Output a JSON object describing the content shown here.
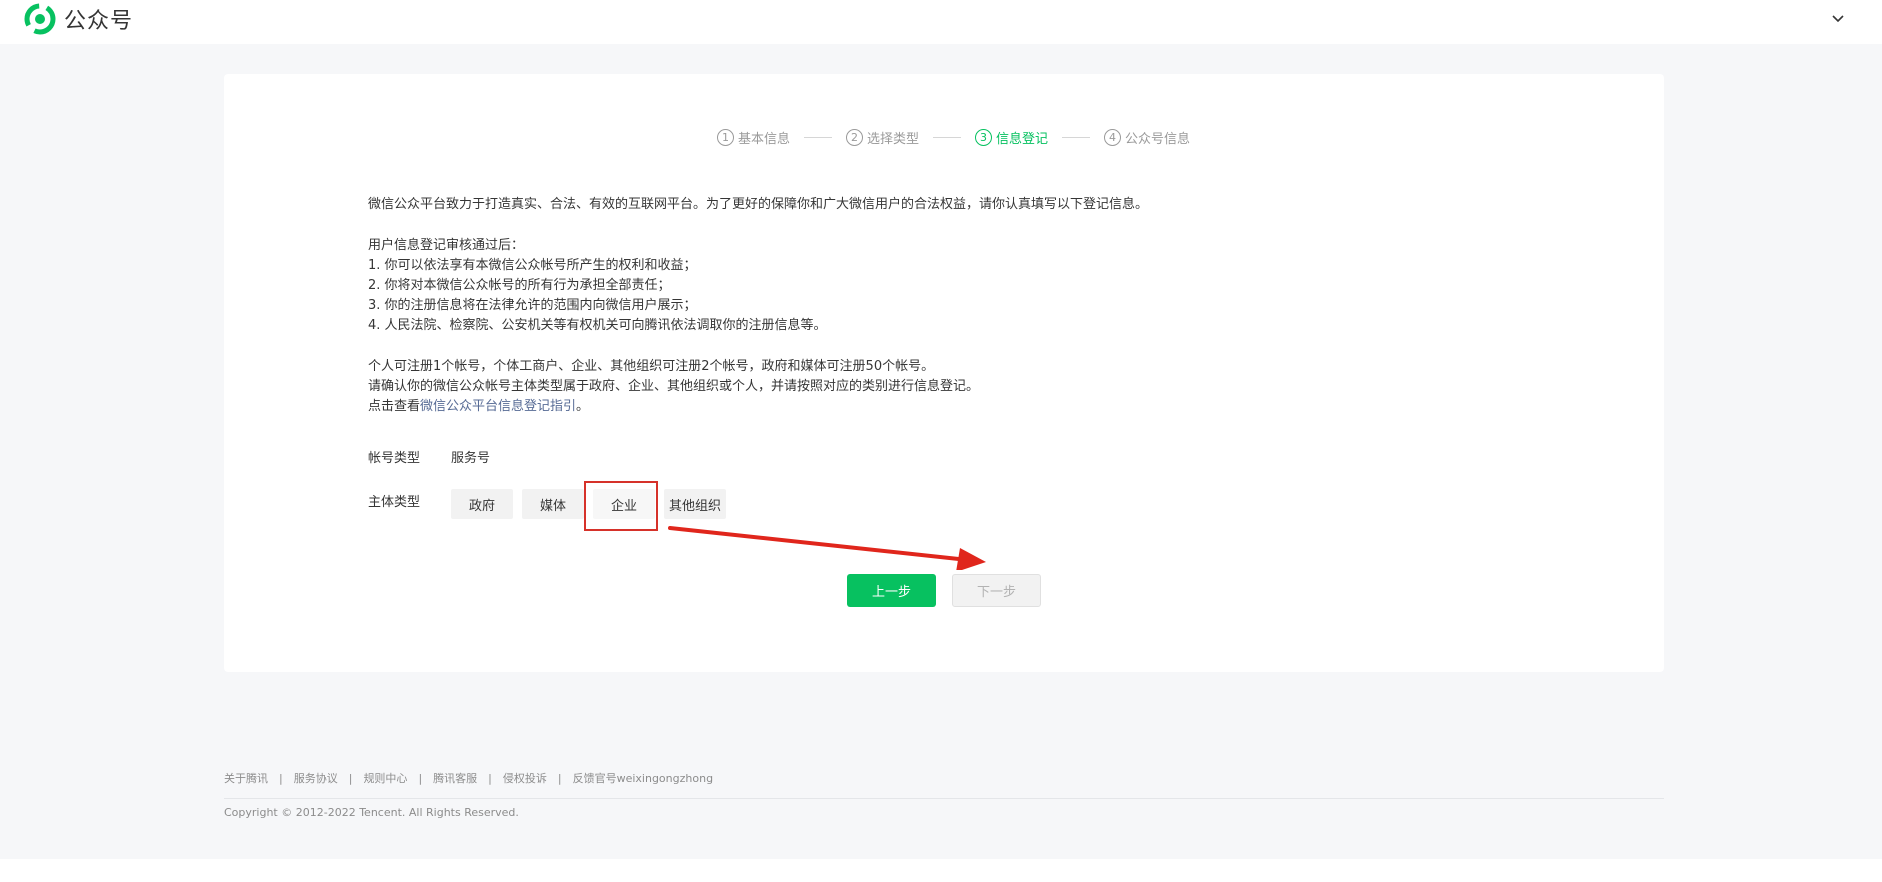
{
  "header": {
    "logo_text": "公众号"
  },
  "steps": [
    {
      "num": "1",
      "label": "基本信息"
    },
    {
      "num": "2",
      "label": "选择类型"
    },
    {
      "num": "3",
      "label": "信息登记"
    },
    {
      "num": "4",
      "label": "公众号信息"
    }
  ],
  "active_step": 3,
  "intro": {
    "line1": "微信公众平台致力于打造真实、合法、有效的互联网平台。为了更好的保障你和广大微信用户的合法权益，请你认真填写以下登记信息。",
    "after_title": "用户信息登记审核通过后：",
    "items": [
      "1. 你可以依法享有本微信公众帐号所产生的权利和收益；",
      "2. 你将对本微信公众帐号的所有行为承担全部责任；",
      "3. 你的注册信息将在法律允许的范围内向微信用户展示；",
      "4. 人民法院、检察院、公安机关等有权机关可向腾讯依法调取你的注册信息等。"
    ],
    "limits": "个人可注册1个帐号，个体工商户、企业、其他组织可注册2个帐号，政府和媒体可注册50个帐号。",
    "confirm": "请确认你的微信公众帐号主体类型属于政府、企业、其他组织或个人，并请按照对应的类别进行信息登记。",
    "guide_prefix": "点击查看",
    "guide_link": "微信公众平台信息登记指引",
    "guide_suffix": "。"
  },
  "form": {
    "account_type_label": "帐号类型",
    "account_type_value": "服务号",
    "subject_type_label": "主体类型",
    "subject_options": [
      "政府",
      "媒体",
      "企业",
      "其他组织"
    ],
    "highlighted_option": "企业"
  },
  "buttons": {
    "prev": "上一步",
    "next": "下一步"
  },
  "footer": {
    "links": [
      "关于腾讯",
      "服务协议",
      "规则中心",
      "腾讯客服",
      "侵权投诉",
      "反馈官号weixingongzhong"
    ],
    "separator": "|",
    "copyright": "Copyright © 2012-2022 Tencent. All Rights Reserved."
  },
  "colors": {
    "brand_green": "#07c160",
    "link_blue": "#576b95",
    "annotation_red": "#e0261c"
  }
}
